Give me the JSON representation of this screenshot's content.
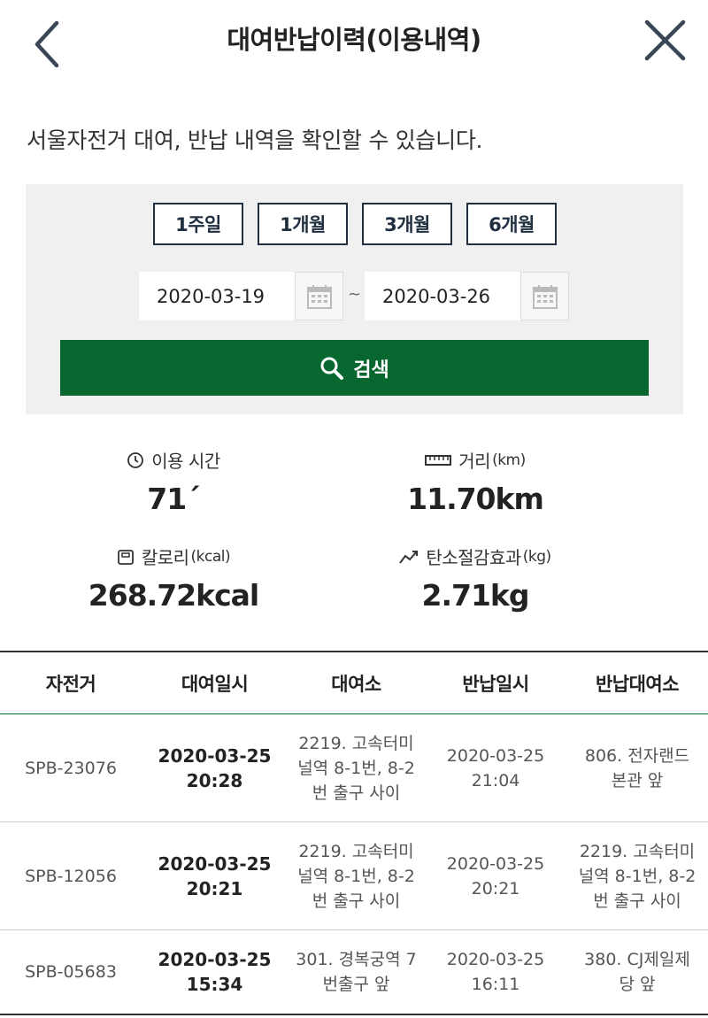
{
  "header": {
    "title": "대여반납이력(이용내역)"
  },
  "intro": "서울자전거 대여, 반납 내역을 확인할 수 있습니다.",
  "search": {
    "periods": [
      "1주일",
      "1개월",
      "3개월",
      "6개월"
    ],
    "start_date": "2020-03-19",
    "end_date": "2020-03-26",
    "separator": "~",
    "search_label": "검색"
  },
  "stats": {
    "time": {
      "label": "이용 시간",
      "unit": "",
      "value": "71´"
    },
    "distance": {
      "label": "거리",
      "unit": "(km)",
      "value": "11.70km"
    },
    "calories": {
      "label": "칼로리",
      "unit": "(kcal)",
      "value": "268.72kcal"
    },
    "carbon": {
      "label": "탄소절감효과",
      "unit": "(kg)",
      "value": "2.71kg"
    }
  },
  "table": {
    "headers": [
      "자전거",
      "대여일시",
      "대여소",
      "반납일시",
      "반납대여소"
    ],
    "rows": [
      {
        "bike": "SPB-23076",
        "rent_time": "2020-03-25\n20:28",
        "rent_station": "2219. 고속터미\n널역 8-1번, 8-2\n번 출구 사이",
        "return_time": "2020-03-25\n21:04",
        "return_station": "806. 전자랜드\n본관 앞"
      },
      {
        "bike": "SPB-12056",
        "rent_time": "2020-03-25\n20:21",
        "rent_station": "2219. 고속터미\n널역 8-1번, 8-2\n번 출구 사이",
        "return_time": "2020-03-25\n20:21",
        "return_station": "2219. 고속터미\n널역 8-1번, 8-2\n번 출구 사이"
      },
      {
        "bike": "SPB-05683",
        "rent_time": "2020-03-25\n15:34",
        "rent_station": "301. 경복궁역 7\n번출구 앞",
        "return_time": "2020-03-25\n16:11",
        "return_station": "380. CJ제일제\n당 앞"
      }
    ]
  },
  "colors": {
    "accent_green": "#07672f",
    "button_border": "#1f2f40",
    "panel_bg": "#f0f0f0"
  },
  "icons": {
    "back": "chevron-left-icon",
    "close": "close-icon",
    "search": "search-icon",
    "calendar": "calendar-icon",
    "time": "clock-icon",
    "distance": "ruler-icon",
    "calories": "scale-icon",
    "carbon": "trend-icon"
  }
}
